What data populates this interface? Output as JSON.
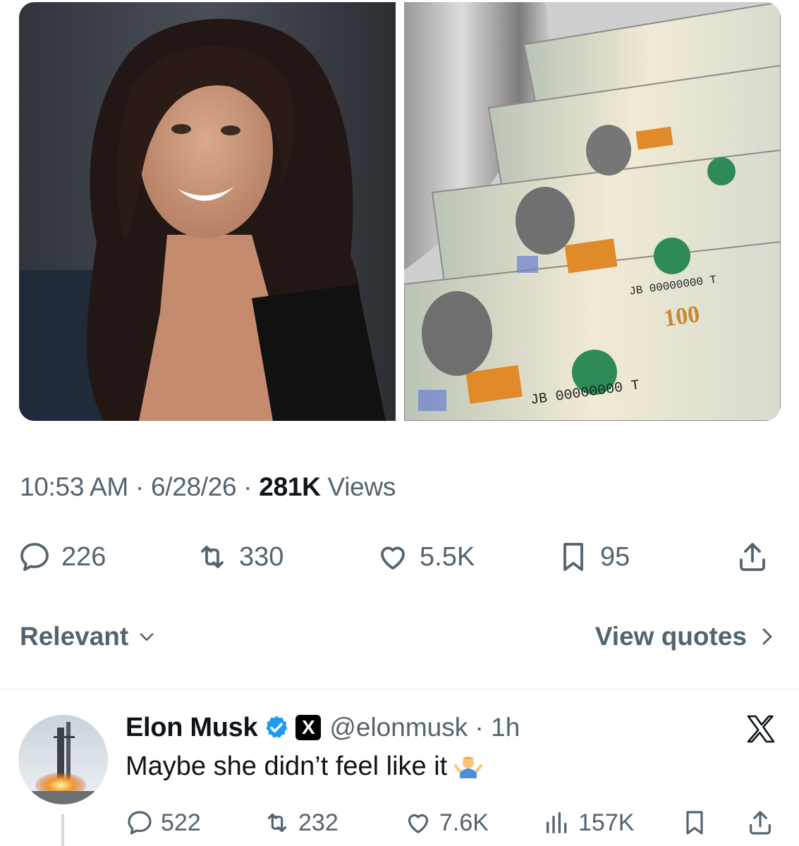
{
  "media": {
    "left_image": "woman-portrait-photo",
    "right_image": "hundred-dollar-bills-printing-photo",
    "bill_serial": "JB 00000000 T",
    "bill_value": "100"
  },
  "post": {
    "time": "10:53 AM",
    "sep1": "·",
    "date": "6/28/26",
    "sep2": "·",
    "views_count": "281K",
    "views_label": "Views"
  },
  "actions": {
    "replies": "226",
    "reposts": "330",
    "likes": "5.5K",
    "bookmarks": "95"
  },
  "sort": {
    "label": "Relevant",
    "quotes_label": "View quotes"
  },
  "reply": {
    "name": "Elon Musk",
    "affiliate_badge": "X",
    "handle": "@elonmusk",
    "sep": "·",
    "age": "1h",
    "text": "Maybe she didn’t feel like it",
    "emoji": "man-shrugging-emoji",
    "replies": "522",
    "reposts": "232",
    "likes": "7.6K",
    "views": "157K"
  },
  "colors": {
    "text_primary": "#0f1419",
    "text_secondary": "#536471",
    "verified_blue": "#1d9bf0",
    "divider": "#e6ecf0"
  }
}
